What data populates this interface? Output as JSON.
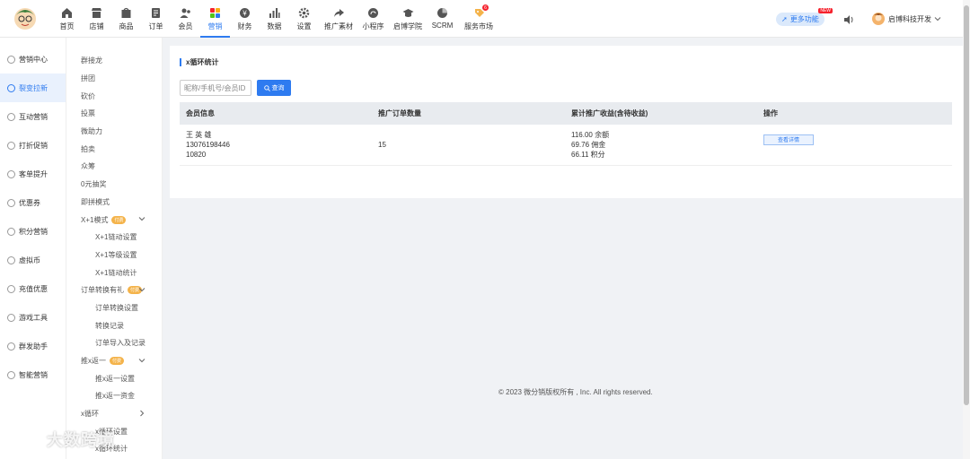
{
  "nav": [
    {
      "label": "首页",
      "icon": "home-icon"
    },
    {
      "label": "店铺",
      "icon": "store-icon"
    },
    {
      "label": "商品",
      "icon": "goods-icon"
    },
    {
      "label": "订单",
      "icon": "order-icon"
    },
    {
      "label": "会员",
      "icon": "member-icon"
    },
    {
      "label": "营销",
      "icon": "marketing-icon"
    },
    {
      "label": "财务",
      "icon": "finance-icon"
    },
    {
      "label": "数据",
      "icon": "data-icon"
    },
    {
      "label": "设置",
      "icon": "settings-icon"
    },
    {
      "label": "推广素材",
      "icon": "share-icon"
    },
    {
      "label": "小程序",
      "icon": "miniprogram-icon"
    },
    {
      "label": "启博学院",
      "icon": "academy-icon"
    },
    {
      "label": "SCRM",
      "icon": "scrm-icon"
    },
    {
      "label": "服务市场",
      "icon": "market-icon"
    }
  ],
  "nav_active_index": 5,
  "nav_badge": "6",
  "header": {
    "more_label": "更多功能",
    "new_badge": "NEW",
    "user_name": "启博科技开发"
  },
  "sidebar1": [
    "营销中心",
    "裂变拉新",
    "互动营销",
    "打折促销",
    "客单提升",
    "优惠券",
    "积分营销",
    "虚拟币",
    "充值优惠",
    "游戏工具",
    "群发助手",
    "智能营销"
  ],
  "sidebar1_active_index": 1,
  "sidebar2": [
    {
      "label": "群接龙",
      "level": 1
    },
    {
      "label": "拼团",
      "level": 1
    },
    {
      "label": "砍价",
      "level": 1
    },
    {
      "label": "投票",
      "level": 1
    },
    {
      "label": "微助力",
      "level": 1
    },
    {
      "label": "拍卖",
      "level": 1
    },
    {
      "label": "众筹",
      "level": 1
    },
    {
      "label": "0元抽奖",
      "level": 1
    },
    {
      "label": "即拼模式",
      "level": 1
    },
    {
      "label": "X+1模式",
      "level": 1,
      "tag": "付费",
      "chevron": "down"
    },
    {
      "label": "X+1链动设置",
      "level": 2
    },
    {
      "label": "X+1等级设置",
      "level": 2
    },
    {
      "label": "X+1链动统计",
      "level": 2
    },
    {
      "label": "订单转换有礼",
      "level": 1,
      "tag": "付费",
      "chevron": "down"
    },
    {
      "label": "订单转换设置",
      "level": 2
    },
    {
      "label": "转换记录",
      "level": 2
    },
    {
      "label": "订单导入及记录",
      "level": 2
    },
    {
      "label": "推x返一",
      "level": 1,
      "tag": "付费",
      "chevron": "down"
    },
    {
      "label": "推x返一设置",
      "level": 2
    },
    {
      "label": "推x返一资金",
      "level": 2
    },
    {
      "label": "x循环",
      "level": 1,
      "chevron": "right"
    },
    {
      "label": "x循环设置",
      "level": 2
    },
    {
      "label": "x循环统计",
      "level": 2
    }
  ],
  "panel": {
    "title": "x循环统计",
    "search_placeholder": "昵称/手机号/会员ID",
    "search_value": "",
    "query_label": "查询"
  },
  "table": {
    "headers": [
      "会员信息",
      "推广订单数量",
      "累计推广收益(含待收益)",
      "操作"
    ],
    "rows": [
      {
        "member_name": "王 英 雄",
        "member_phone": "13076198446",
        "member_id": "10820",
        "order_count": "15",
        "earning_balance": "116.00 余额",
        "earning_commission": "69.76 佣金",
        "earning_points": "66.11 积分",
        "action_label": "查看详情"
      }
    ]
  },
  "footer": "© 2023 微分销版权所有 , Inc. All rights reserved.",
  "watermark": "大数跨境",
  "colors": {
    "accent": "#2e7bf0",
    "tag": "#f4b34a",
    "new_badge": "#f5222d"
  }
}
